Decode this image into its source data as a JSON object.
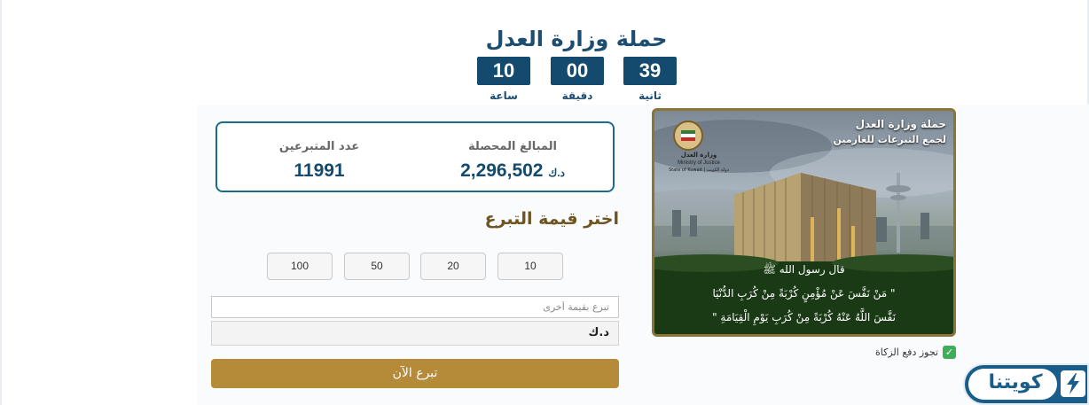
{
  "page": {
    "title": "حملة وزارة العدل"
  },
  "countdown": [
    {
      "value": "39",
      "label": "ثانية"
    },
    {
      "value": "00",
      "label": "دقيقة"
    },
    {
      "value": "10",
      "label": "ساعة"
    }
  ],
  "stats": {
    "collected_label": "المبالغ المحصلة",
    "collected_value": "2,296,502",
    "collected_currency": "د.ك",
    "donors_label": "عدد المتبرعين",
    "donors_value": "11991"
  },
  "donation": {
    "choose_label": "اختر قيمة التبرع",
    "amounts": [
      "10",
      "20",
      "50",
      "100"
    ],
    "other_placeholder": "تبرع بقيمة أخرى",
    "currency": "د.ك",
    "donate_button": "تبرع الآن"
  },
  "banner": {
    "title_line1": "حملة وزارة العدل",
    "title_line2": "لجمع التبرعات للغارمين",
    "ministry_ar": "وزارة العدل",
    "ministry_en": "Ministry of Justice",
    "country": "State of Kuwait | دولة الكويت",
    "quote_intro": "قال رسول الله ﷺ",
    "quote_line1": "\" مَنْ نَفَّسَ عَنْ مُؤْمِنٍ كُرْبَةً مِنْ كُرَبِ الدُّنْيَا",
    "quote_line2": "نَفَّسَ اللَّهُ عَنْهُ كُرْبَةً مِنْ كُرَبِ يَوْمِ الْقِيَامَةِ \""
  },
  "zakat": {
    "label": "تجوز دفع الزكاة",
    "checked": true
  },
  "brand": {
    "logo_text": "كويتنا"
  }
}
